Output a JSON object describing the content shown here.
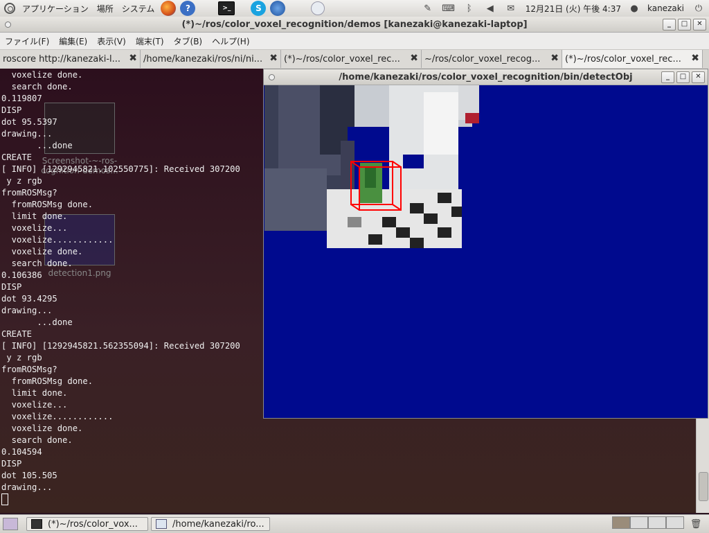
{
  "top_panel": {
    "menus": [
      "アプリケーション",
      "場所",
      "システム"
    ],
    "launchers": [
      "firefox-icon",
      "help-icon",
      "terminal-icon",
      "skype-icon",
      "thunderbird-icon"
    ],
    "datetime": "12月21日 (火) 午後 4:37",
    "user": "kanezaki"
  },
  "terminal": {
    "title": "(*)~/ros/color_voxel_recognition/demos [kanezaki@kanezaki-laptop]",
    "menu": [
      "ファイル(F)",
      "編集(E)",
      "表示(V)",
      "端末(T)",
      "タブ(B)",
      "ヘルプ(H)"
    ],
    "tabs": [
      {
        "label": "roscore http://kanezaki-l..."
      },
      {
        "label": "/home/kanezaki/ros/ni/ni..."
      },
      {
        "label": "(*)~/ros/color_voxel_rec..."
      },
      {
        "label": "~/ros/color_voxel_recog..."
      },
      {
        "label": "(*)~/ros/color_voxel_rec..."
      }
    ],
    "lines": [
      "  voxelize done.",
      "  search done.",
      "0.119807",
      "DISP",
      "dot 95.5397",
      "drawing...",
      "       ...done",
      "CREATE",
      "[ INFO] [1292945821.102550775]: Received 307200",
      " y z rgb",
      "fromROSMsg?",
      "  fromROSMsg done.",
      "  limit done.",
      "  voxelize...",
      "  voxelize............",
      "  voxelize done.",
      "  search done.",
      "0.106386",
      "DISP",
      "dot 93.4295",
      "drawing...",
      "       ...done",
      "CREATE",
      "[ INFO] [1292945821.562355094]: Received 307200",
      " y z rgb",
      "fromROSMsg?",
      "  fromROSMsg done.",
      "  limit done.",
      "  voxelize...",
      "  voxelize............",
      "  voxelize done.",
      "  search done.",
      "0.104594",
      "DISP",
      "dot 105.505",
      "drawing..."
    ],
    "desktop_icons": [
      {
        "label": "Screenshot-~-ros-\ncognition-demos..."
      },
      {
        "label": "detection1.png"
      }
    ]
  },
  "detect_window": {
    "title": "/home/kanezaki/ros/color_voxel_recognition/bin/detectObj",
    "background_color": "#000a8e",
    "bbox_color": "#ff0000"
  },
  "taskbar": {
    "tasks": [
      {
        "label": "(*)~/ros/color_vox..."
      },
      {
        "label": "/home/kanezaki/ro..."
      }
    ]
  }
}
